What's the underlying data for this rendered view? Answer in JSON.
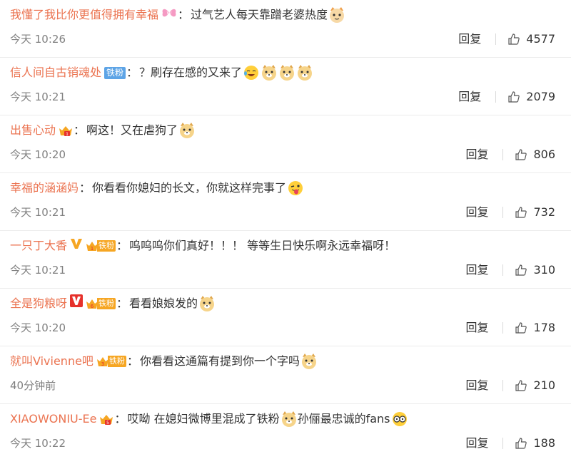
{
  "comments": [
    {
      "user": "我懂了我比你更值得拥有幸福",
      "text": "过气艺人每天靠蹭老婆热度",
      "time": "今天 10:26",
      "reply": "回复",
      "likes": "4577"
    },
    {
      "user": "信人间自古销魂处",
      "badge": "铁粉",
      "text": "？刷存在感的又来了",
      "time": "今天 10:21",
      "reply": "回复",
      "likes": "2079"
    },
    {
      "user": "出售心动",
      "text": "啊这！又在虐狗了",
      "time": "今天 10:20",
      "reply": "回复",
      "likes": "806"
    },
    {
      "user": "幸福的涵涵妈",
      "text": "你看看你媳妇的长文，你就这样完事了",
      "time": "今天 10:21",
      "reply": "回复",
      "likes": "732"
    },
    {
      "user": "一只丁大香",
      "badge": "铁粉",
      "text": "呜呜呜你们真好！！！ 等等生日快乐啊永远幸福呀！",
      "time": "今天 10:21",
      "reply": "回复",
      "likes": "310"
    },
    {
      "user": "全是狗粮呀",
      "badge": "铁粉",
      "text": "看看娘娘发的",
      "time": "今天 10:20",
      "reply": "回复",
      "likes": "178"
    },
    {
      "user": "就叫Vivienne吧",
      "badge": "铁粉",
      "text": "你看看这通篇有提到你一个字吗",
      "time": "40分钟前",
      "reply": "回复",
      "likes": "210"
    },
    {
      "user": "XIAOWONIU-Ee",
      "text": "哎呦 在媳妇微博里混成了铁粉",
      "text2": "孙俪最忠诚的fans",
      "time": "今天 10:22",
      "reply": "回复",
      "likes": "188"
    }
  ],
  "colors": {
    "username": "#eb7350",
    "text": "#333333",
    "meta": "#808080",
    "badge_blue": "#5da4e6",
    "badge_orange": "#f6a623"
  }
}
